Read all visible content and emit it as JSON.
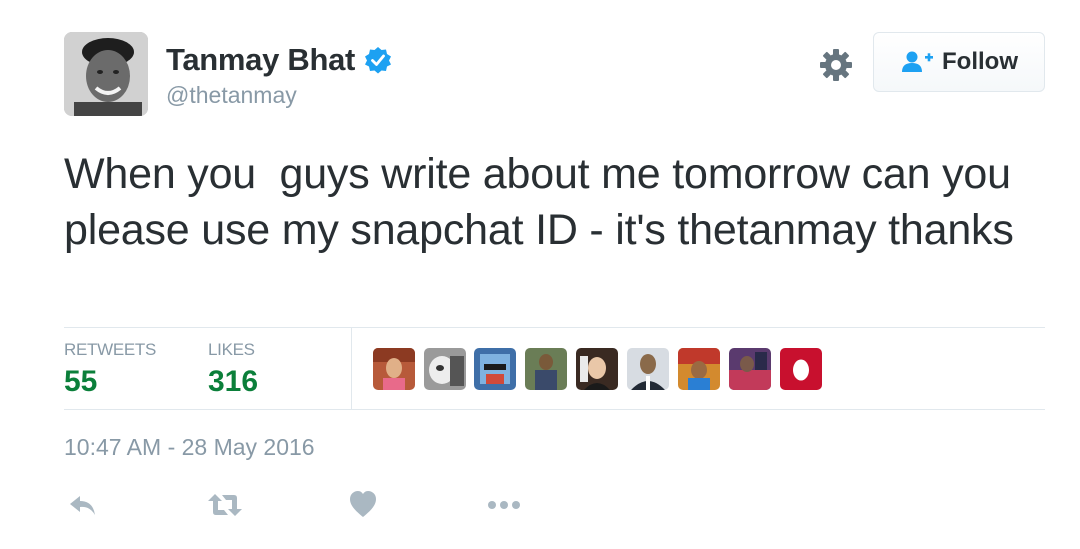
{
  "user": {
    "display_name": "Tanmay Bhat",
    "handle": "@thetanmay",
    "verified": true,
    "avatar_icon": "profile-photo"
  },
  "follow_button": {
    "label": "Follow",
    "icon": "add-user-icon",
    "accent": "#1da1f2"
  },
  "settings_icon": "gear-icon",
  "tweet": {
    "text": "When you  guys write about me tomorrow can you please use my snapchat ID - it's thetanmay thanks",
    "timestamp": "10:47 AM - 28 May 2016"
  },
  "stats": {
    "retweets_label": "RETWEETS",
    "retweets_count": "55",
    "likes_label": "LIKES",
    "likes_count": "316",
    "count_color": "#0b7f3a"
  },
  "likers": [
    {
      "icon": "liker-avatar-1",
      "color": "#b75a3a"
    },
    {
      "icon": "liker-avatar-2",
      "color": "#8a8a8a"
    },
    {
      "icon": "liker-avatar-3",
      "color": "#3f6fa8"
    },
    {
      "icon": "liker-avatar-4",
      "color": "#6a7d56"
    },
    {
      "icon": "liker-avatar-5",
      "color": "#3a2a22"
    },
    {
      "icon": "liker-avatar-6",
      "color": "#4b5562"
    },
    {
      "icon": "liker-avatar-7",
      "color": "#d38a2e"
    },
    {
      "icon": "liker-avatar-8",
      "color": "#5a3a6e"
    },
    {
      "icon": "egg-avatar",
      "color": "#c8102e"
    }
  ],
  "actions": [
    "reply-icon",
    "retweet-icon",
    "like-icon",
    "more-icon"
  ]
}
